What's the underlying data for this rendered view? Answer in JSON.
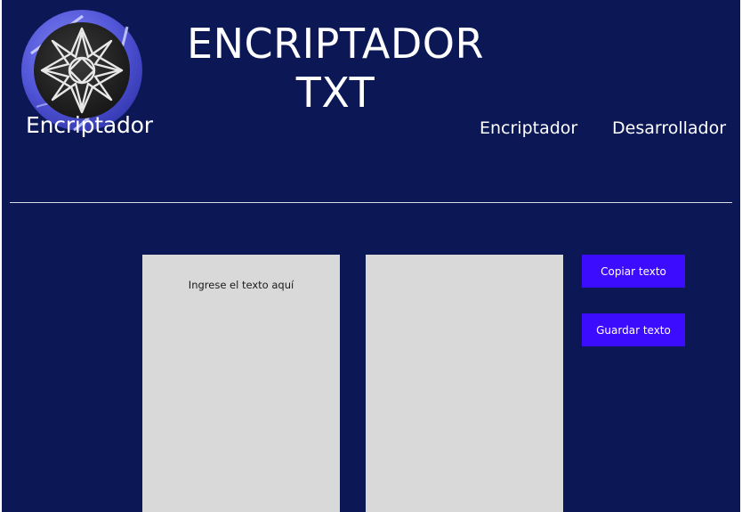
{
  "header": {
    "logo_label": "Encriptador",
    "title_line1": "ENCRIPTADOR",
    "title_line2": "TXT",
    "nav": [
      "Encriptador",
      "Desarrollador"
    ]
  },
  "main": {
    "input": {
      "placeholder": "Ingrese el texto aquí",
      "value": ""
    },
    "output": {
      "value": ""
    },
    "buttons": {
      "copy_label": "Copiar texto",
      "save_label": "Guardar texto"
    }
  },
  "colors": {
    "background": "#0c1756",
    "button": "#3c0cff",
    "textbox": "#d9d9d9",
    "text": "#ffffff"
  },
  "icons": {
    "logo": "star-compass-icon"
  }
}
